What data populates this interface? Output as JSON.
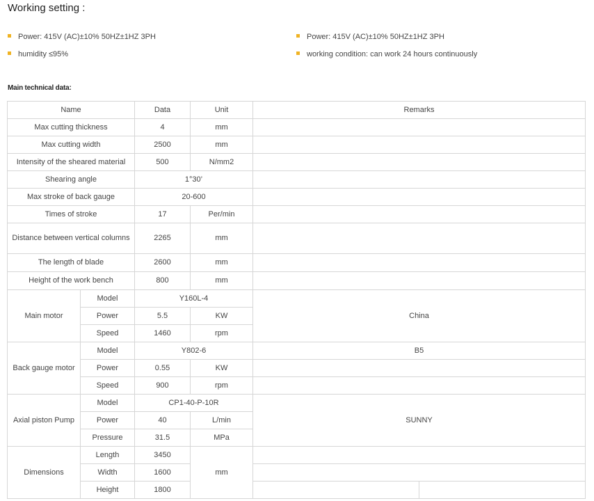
{
  "working": {
    "title": "Working setting :",
    "bullets_left": [
      "Power: 415V (AC)±10% 50HZ±1HZ 3PH",
      "humidity ≤95%"
    ],
    "bullets_right": [
      "Power: 415V (AC)±10% 50HZ±1HZ 3PH",
      "working condition: can work 24 hours continuously"
    ],
    "bullet_color": "#f0b323"
  },
  "main": {
    "title": "Main technical data:"
  },
  "table": {
    "headers": {
      "name": "Name",
      "data": "Data",
      "unit": "Unit",
      "remarks": "Remarks"
    },
    "rows": [
      {
        "name": "Max cutting thickness",
        "data": "4",
        "unit": "mm"
      },
      {
        "name": "Max cutting width",
        "data": "2500",
        "unit": "mm"
      },
      {
        "name": "Intensity of the sheared material",
        "data": "500",
        "unit": "N/mm2"
      },
      {
        "name": "Shearing angle",
        "data": "1°30’"
      },
      {
        "name": "Max stroke of back gauge",
        "data": "20-600"
      },
      {
        "name": "Times of stroke",
        "data": "17",
        "unit": "Per/min"
      },
      {
        "name": "Distance between vertical columns",
        "data": "2265",
        "unit": "mm"
      },
      {
        "name": "The length of blade",
        "data": "2600",
        "unit": "mm"
      },
      {
        "name": "Height of the work bench",
        "data": "800",
        "unit": "mm"
      }
    ],
    "main_motor": {
      "group": "Main motor",
      "model_label": "Model",
      "model": "Y160L-4",
      "power_label": "Power",
      "power": "5.5",
      "power_unit": "KW",
      "speed_label": "Speed",
      "speed": "1460",
      "speed_unit": "rpm",
      "remark": "China"
    },
    "back_gauge_motor": {
      "group": "Back gauge motor",
      "model_label": "Model",
      "model": "Y802-6",
      "model_remark": "B5",
      "power_label": "Power",
      "power": "0.55",
      "power_unit": "KW",
      "speed_label": "Speed",
      "speed": "900",
      "speed_unit": "rpm"
    },
    "pump": {
      "group": "Axial piston Pump",
      "model_label": "Model",
      "model": "CP1-40-P-10R",
      "power_label": "Power",
      "power": "40",
      "power_unit": "L/min",
      "pressure_label": "Pressure",
      "pressure": "31.5",
      "pressure_unit": "MPa",
      "remark": "SUNNY"
    },
    "dimensions": {
      "group": "Dimensions",
      "length_label": "Length",
      "length": "3450",
      "width_label": "Width",
      "width": "1600",
      "height_label": "Height",
      "height": "1800",
      "unit": "mm"
    }
  }
}
